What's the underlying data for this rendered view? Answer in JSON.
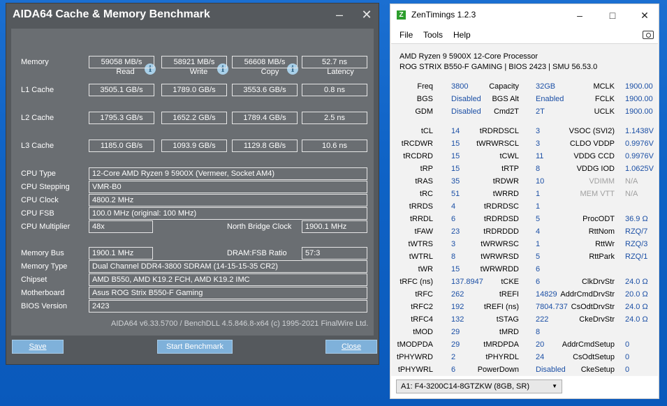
{
  "aida": {
    "title": "AIDA64 Cache & Memory Benchmark",
    "headers": [
      "Read",
      "Write",
      "Copy",
      "Latency"
    ],
    "bench_rows": [
      {
        "label": "Memory",
        "read": "59058 MB/s",
        "write": "58921 MB/s",
        "copy": "56608 MB/s",
        "latency": "52.7 ns"
      },
      {
        "label": "L1 Cache",
        "read": "3505.1 GB/s",
        "write": "1789.0 GB/s",
        "copy": "3553.6 GB/s",
        "latency": "0.8 ns"
      },
      {
        "label": "L2 Cache",
        "read": "1795.3 GB/s",
        "write": "1652.2 GB/s",
        "copy": "1789.4 GB/s",
        "latency": "2.5 ns"
      },
      {
        "label": "L3 Cache",
        "read": "1185.0 GB/s",
        "write": "1093.9 GB/s",
        "copy": "1129.8 GB/s",
        "latency": "10.6 ns"
      }
    ],
    "cpu": {
      "type_label": "CPU Type",
      "type": "12-Core AMD Ryzen 9 5900X  (Vermeer, Socket AM4)",
      "stepping_label": "CPU Stepping",
      "stepping": "VMR-B0",
      "clock_label": "CPU Clock",
      "clock": "4800.2 MHz",
      "fsb_label": "CPU FSB",
      "fsb": "100.0 MHz  (original: 100 MHz)",
      "mult_label": "CPU Multiplier",
      "mult": "48x",
      "nb_label": "North Bridge Clock",
      "nb": "1900.1 MHz"
    },
    "mem": {
      "bus_label": "Memory Bus",
      "bus": "1900.1 MHz",
      "ratio_label": "DRAM:FSB Ratio",
      "ratio": "57:3",
      "type_label": "Memory Type",
      "type": "Dual Channel DDR4-3800 SDRAM  (14-15-15-35 CR2)",
      "chipset_label": "Chipset",
      "chipset": "AMD B550, AMD K19.2 FCH, AMD K19.2 IMC",
      "mobo_label": "Motherboard",
      "mobo": "Asus ROG Strix B550-F Gaming",
      "bios_label": "BIOS Version",
      "bios": "2423"
    },
    "footer": "AIDA64 v6.33.5700 / BenchDLL 4.5.846.8-x64  (c) 1995-2021 FinalWire Ltd.",
    "buttons": {
      "save": "Save",
      "start": "Start Benchmark",
      "close": "Close"
    }
  },
  "zen": {
    "title": "ZenTimings 1.2.3",
    "menu": [
      "File",
      "Tools",
      "Help"
    ],
    "cpu_line": "AMD Ryzen 9 5900X 12-Core Processor",
    "board_line": "ROG STRIX B550-F GAMING | BIOS 2423 | SMU 56.53.0",
    "top": [
      [
        {
          "l": "Freq",
          "v": "3800"
        },
        {
          "l": "Capacity",
          "v": "32GB"
        },
        {
          "l": "MCLK",
          "v": "1900.00"
        }
      ],
      [
        {
          "l": "BGS",
          "v": "Disabled"
        },
        {
          "l": "BGS Alt",
          "v": "Enabled"
        },
        {
          "l": "FCLK",
          "v": "1900.00"
        }
      ],
      [
        {
          "l": "GDM",
          "v": "Disabled"
        },
        {
          "l": "Cmd2T",
          "v": "2T"
        },
        {
          "l": "UCLK",
          "v": "1900.00"
        }
      ]
    ],
    "timings": [
      [
        {
          "l": "tCL",
          "v": "14"
        },
        {
          "l": "tRDRDSCL",
          "v": "3"
        },
        {
          "l": "VSOC (SVI2)",
          "v": "1.1438V"
        }
      ],
      [
        {
          "l": "tRCDWR",
          "v": "15"
        },
        {
          "l": "tWRWRSCL",
          "v": "3"
        },
        {
          "l": "CLDO VDDP",
          "v": "0.9976V"
        }
      ],
      [
        {
          "l": "tRCDRD",
          "v": "15"
        },
        {
          "l": "tCWL",
          "v": "11"
        },
        {
          "l": "VDDG CCD",
          "v": "0.9976V"
        }
      ],
      [
        {
          "l": "tRP",
          "v": "15"
        },
        {
          "l": "tRTP",
          "v": "8"
        },
        {
          "l": "VDDG IOD",
          "v": "1.0625V"
        }
      ],
      [
        {
          "l": "tRAS",
          "v": "35"
        },
        {
          "l": "tRDWR",
          "v": "10"
        },
        {
          "l": "VDIMM",
          "v": "N/A"
        }
      ],
      [
        {
          "l": "tRC",
          "v": "51"
        },
        {
          "l": "tWRRD",
          "v": "1"
        },
        {
          "l": "MEM VTT",
          "v": "N/A"
        }
      ],
      [
        {
          "l": "tRRDS",
          "v": "4"
        },
        {
          "l": "tRDRDSC",
          "v": "1"
        },
        {
          "l": "",
          "v": ""
        }
      ],
      [
        {
          "l": "tRRDL",
          "v": "6"
        },
        {
          "l": "tRDRDSD",
          "v": "5"
        },
        {
          "l": "ProcODT",
          "v": "36.9 Ω"
        }
      ],
      [
        {
          "l": "tFAW",
          "v": "23"
        },
        {
          "l": "tRDRDDD",
          "v": "4"
        },
        {
          "l": "RttNom",
          "v": "RZQ/7"
        }
      ],
      [
        {
          "l": "tWTRS",
          "v": "3"
        },
        {
          "l": "tWRWRSC",
          "v": "1"
        },
        {
          "l": "RttWr",
          "v": "RZQ/3"
        }
      ],
      [
        {
          "l": "tWTRL",
          "v": "8"
        },
        {
          "l": "tWRWRSD",
          "v": "5"
        },
        {
          "l": "RttPark",
          "v": "RZQ/1"
        }
      ],
      [
        {
          "l": "tWR",
          "v": "15"
        },
        {
          "l": "tWRWRDD",
          "v": "6"
        },
        {
          "l": "",
          "v": ""
        }
      ],
      [
        {
          "l": "tRFC (ns)",
          "v": "137.8947"
        },
        {
          "l": "tCKE",
          "v": "6"
        },
        {
          "l": "ClkDrvStr",
          "v": "24.0 Ω"
        }
      ],
      [
        {
          "l": "tRFC",
          "v": "262"
        },
        {
          "l": "tREFI",
          "v": "14829"
        },
        {
          "l": "AddrCmdDrvStr",
          "v": "20.0 Ω"
        }
      ],
      [
        {
          "l": "tRFC2",
          "v": "192"
        },
        {
          "l": "tREFI (ns)",
          "v": "7804.737"
        },
        {
          "l": "CsOdtDrvStr",
          "v": "24.0 Ω"
        }
      ],
      [
        {
          "l": "tRFC4",
          "v": "132"
        },
        {
          "l": "tSTAG",
          "v": "222"
        },
        {
          "l": "CkeDrvStr",
          "v": "24.0 Ω"
        }
      ],
      [
        {
          "l": "tMOD",
          "v": "29"
        },
        {
          "l": "tMRD",
          "v": "8"
        },
        {
          "l": "",
          "v": ""
        }
      ],
      [
        {
          "l": "tMODPDA",
          "v": "29"
        },
        {
          "l": "tMRDPDA",
          "v": "20"
        },
        {
          "l": "AddrCmdSetup",
          "v": "0"
        }
      ],
      [
        {
          "l": "tPHYWRD",
          "v": "2"
        },
        {
          "l": "tPHYRDL",
          "v": "24"
        },
        {
          "l": "CsOdtSetup",
          "v": "0"
        }
      ],
      [
        {
          "l": "tPHYWRL",
          "v": "6"
        },
        {
          "l": "PowerDown",
          "v": "Disabled"
        },
        {
          "l": "CkeSetup",
          "v": "0"
        }
      ]
    ],
    "dim_labels": [
      "VDIMM",
      "MEM VTT"
    ],
    "module": "A1: F4-3200C14-8GTZKW (8GB, SR)"
  }
}
